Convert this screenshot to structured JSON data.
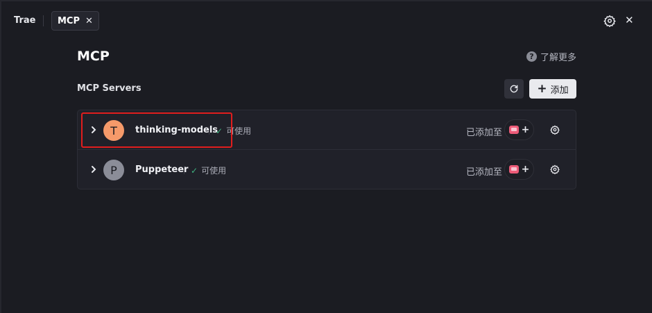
{
  "tabs": [
    {
      "label": "Trae"
    },
    {
      "label": "MCP",
      "active": true
    }
  ],
  "header": {
    "title": "MCP",
    "learn_more_label": "了解更多",
    "help_icon_glyph": "?"
  },
  "section": {
    "title": "MCP Servers",
    "add_label": "添加"
  },
  "servers": [
    {
      "initial": "T",
      "name": "thinking-models",
      "status": "可使用",
      "added_to_label": "已添加至",
      "avatar_color": "#f59a6a",
      "highlighted": true
    },
    {
      "initial": "P",
      "name": "Puppeteer",
      "status": "可使用",
      "added_to_label": "已添加至",
      "avatar_color": "#8b8d98"
    }
  ],
  "icons": {
    "tab_close": "close-icon",
    "settings": "gear-icon",
    "window_close": "close-icon",
    "refresh": "refresh-icon",
    "add": "plus-icon",
    "expand": "chevron-right-icon",
    "status": "check-icon",
    "agent": "agent-icon"
  },
  "colors": {
    "background": "#1b1c22",
    "status_ok": "#3fb37f",
    "highlight": "#e11d1d",
    "agent_brand": "#ec5b78"
  }
}
